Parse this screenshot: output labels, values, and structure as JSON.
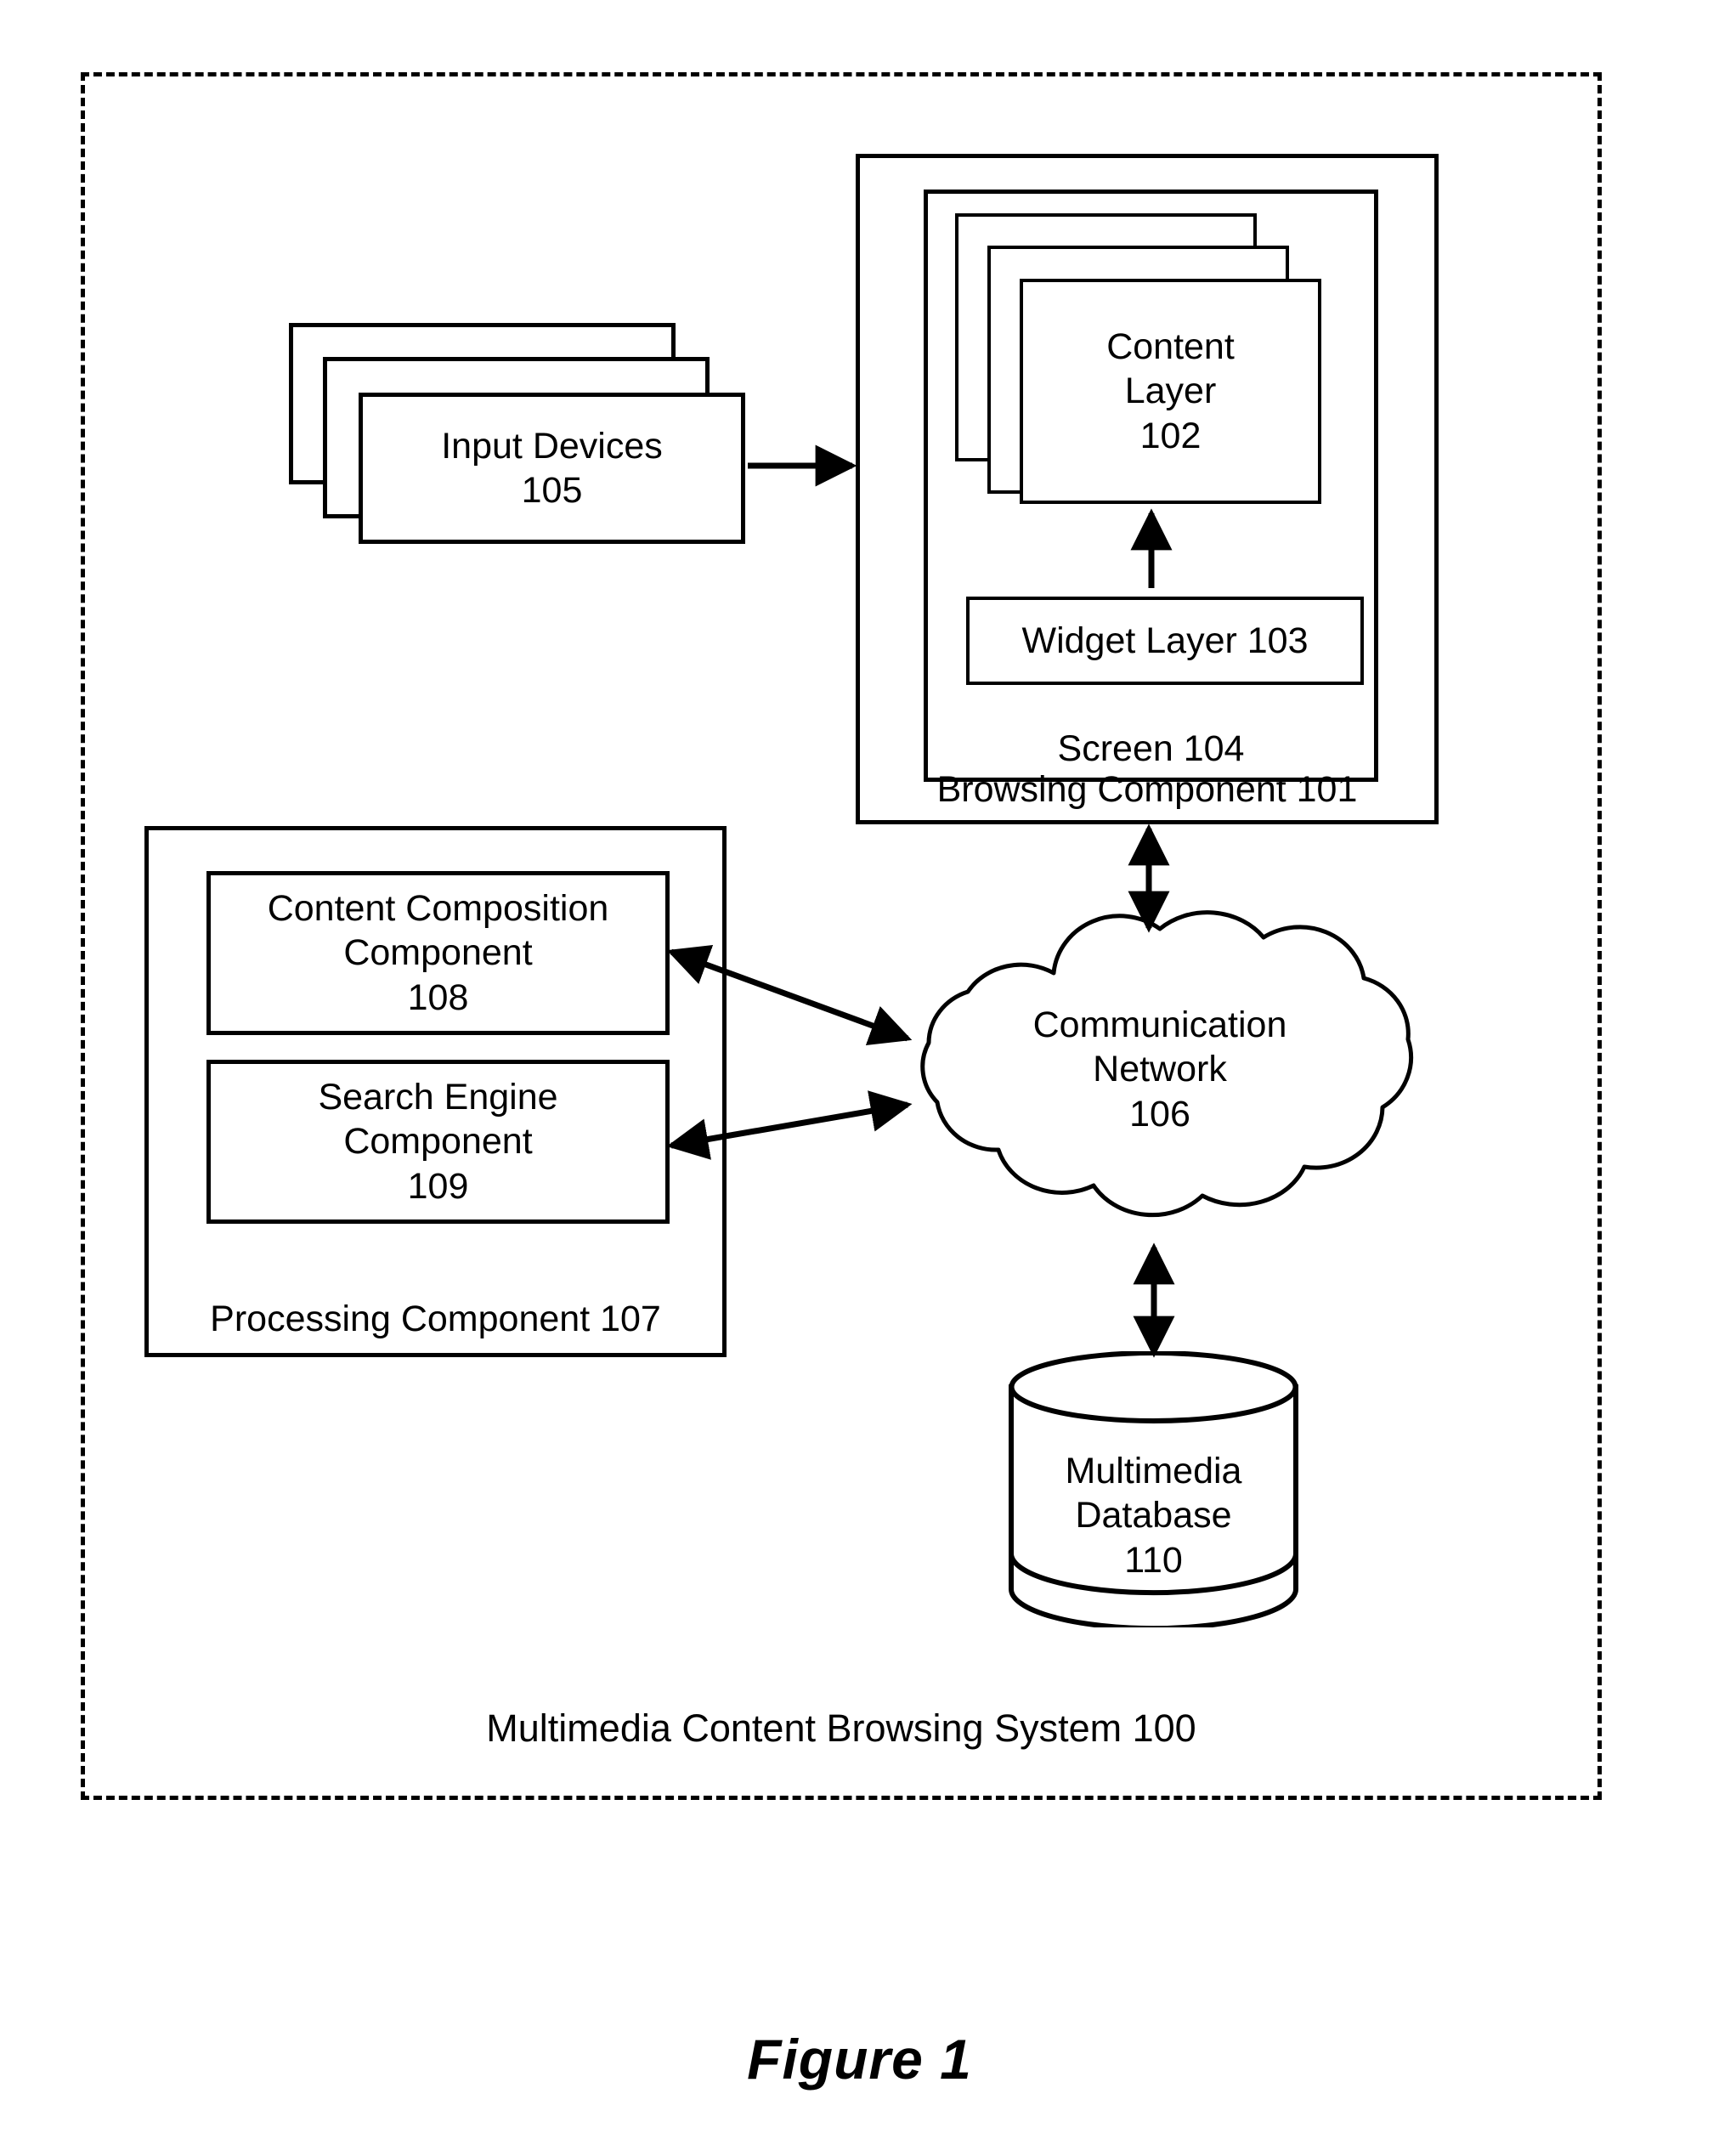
{
  "figure": {
    "caption": "Figure 1"
  },
  "system": {
    "caption": "Multimedia Content Browsing System 100"
  },
  "input_devices": {
    "label": "Input Devices\n105"
  },
  "browsing_component": {
    "label": "Browsing Component 101",
    "screen": {
      "label": "Screen 104",
      "content_layer": {
        "label": "Content\nLayer\n102"
      },
      "widget_layer": {
        "label": "Widget Layer 103"
      }
    }
  },
  "processing_component": {
    "label": "Processing Component 107",
    "content_composition": {
      "label": "Content Composition\nComponent\n108"
    },
    "search_engine": {
      "label": "Search Engine\nComponent\n109"
    }
  },
  "communication_network": {
    "label": "Communication\nNetwork\n106"
  },
  "multimedia_database": {
    "label": "Multimedia\nDatabase\n110"
  },
  "colors": {
    "stroke": "#000000",
    "background": "#ffffff"
  }
}
